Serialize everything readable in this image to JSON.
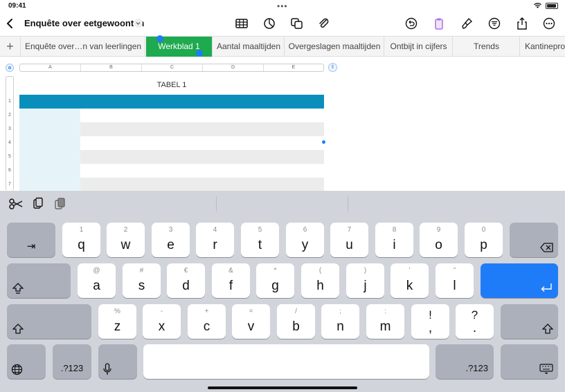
{
  "status": {
    "time": "09:41"
  },
  "toolbar": {
    "title": "Enquête over eetgewoonten"
  },
  "tabs": [
    {
      "label": "Enquête over…n van leerlingen",
      "active": false
    },
    {
      "label": "Werkblad 1",
      "active": true
    },
    {
      "label": "Aantal maaltijden",
      "active": false
    },
    {
      "label": "Overgeslagen maaltijden",
      "active": false
    },
    {
      "label": "Ontbijt in cijfers",
      "active": false
    },
    {
      "label": "Trends",
      "active": false
    },
    {
      "label": "Kantinepro",
      "active": false
    }
  ],
  "grid": {
    "columns": [
      "A",
      "B",
      "C",
      "D",
      "E"
    ],
    "rows": [
      "1",
      "2",
      "3",
      "4",
      "5",
      "6",
      "7"
    ],
    "table_title": "TABEL 1"
  },
  "colors": {
    "active_tab": "#1eaa4e",
    "header_row": "#0a8fbd",
    "header_col": "#e6f4fa",
    "selection": "#1f7cf8",
    "keyboard_bg": "#d1d4da",
    "return_key": "#1f7cf8"
  },
  "keyboard": {
    "row1": [
      {
        "main": "q",
        "sub": "1"
      },
      {
        "main": "w",
        "sub": "2"
      },
      {
        "main": "e",
        "sub": "3"
      },
      {
        "main": "r",
        "sub": "4"
      },
      {
        "main": "t",
        "sub": "5"
      },
      {
        "main": "y",
        "sub": "6"
      },
      {
        "main": "u",
        "sub": "7"
      },
      {
        "main": "i",
        "sub": "8"
      },
      {
        "main": "o",
        "sub": "9"
      },
      {
        "main": "p",
        "sub": "0"
      }
    ],
    "row2": [
      {
        "main": "a",
        "sub": "@"
      },
      {
        "main": "s",
        "sub": "#"
      },
      {
        "main": "d",
        "sub": "€"
      },
      {
        "main": "f",
        "sub": "&"
      },
      {
        "main": "g",
        "sub": "*"
      },
      {
        "main": "h",
        "sub": "("
      },
      {
        "main": "j",
        "sub": ")"
      },
      {
        "main": "k",
        "sub": "’"
      },
      {
        "main": "l",
        "sub": "”"
      }
    ],
    "row3": [
      {
        "main": "z",
        "sub": "%"
      },
      {
        "main": "x",
        "sub": "-"
      },
      {
        "main": "c",
        "sub": "+"
      },
      {
        "main": "v",
        "sub": "="
      },
      {
        "main": "b",
        "sub": "/"
      },
      {
        "main": "n",
        "sub": ";"
      },
      {
        "main": "m",
        "sub": ":"
      },
      {
        "main": ",",
        "sub": "!"
      },
      {
        "main": ".",
        "sub": "?"
      }
    ],
    "numbers_label": ".?123",
    "icons": {
      "tab": "tab-icon",
      "delete": "delete-icon",
      "caps": "caps-lock-icon",
      "return": "return-icon",
      "shift": "shift-icon",
      "globe": "globe-icon",
      "mic": "microphone-icon",
      "hide": "keyboard-hide-icon",
      "cut": "scissors-icon",
      "copy": "copy-icon",
      "paste": "paste-icon"
    }
  }
}
